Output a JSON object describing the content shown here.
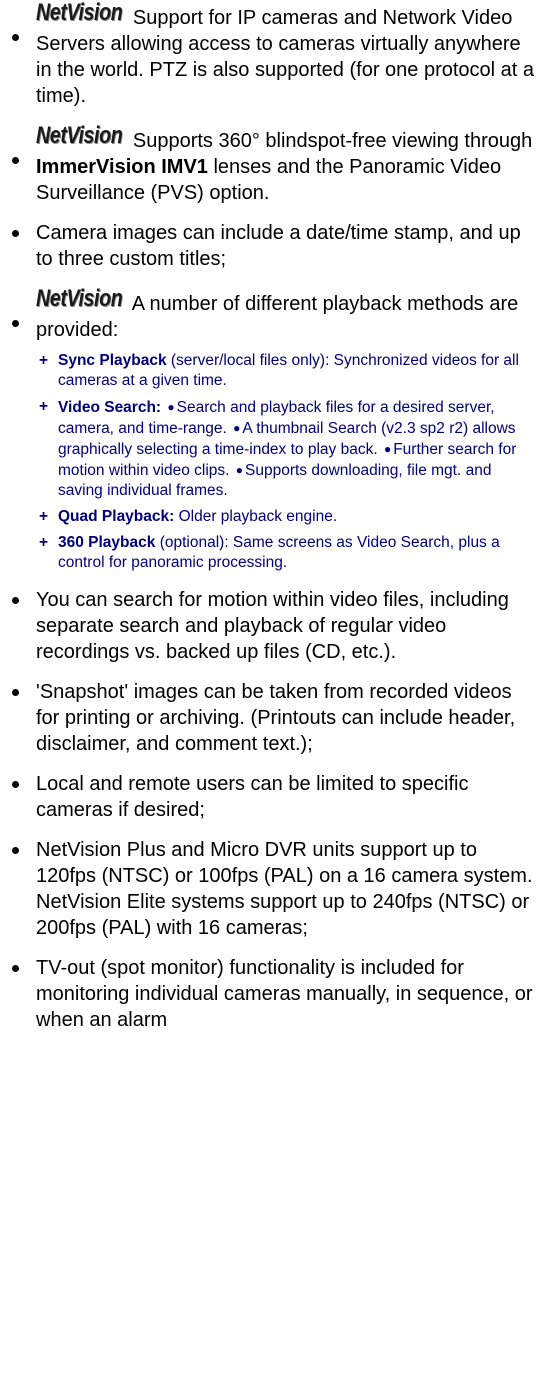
{
  "brand": {
    "logo_text": "NetVision"
  },
  "items": [
    {
      "text": "Support for IP cameras and Network Video Servers allowing access to cameras virtually anywhere in the world. PTZ is also supported (for one protocol at a time)."
    },
    {
      "before": "Supports 360° blindspot-free viewing through ",
      "bold": "ImmerVision IMV1",
      "after": " lenses and the Panoramic Video Surveillance (PVS) option."
    },
    {
      "text": "Camera images can include a date/time stamp, and up to three custom titles;"
    },
    {
      "text": "A number of different playback methods are provided:"
    },
    {
      "text": "You can search for motion within video files, including separate search and playback of regular video recordings vs. backed up files (CD, etc.)."
    },
    {
      "text": "'Snapshot' images can be taken from recorded videos for printing or archiving. (Printouts can include header, disclaimer, and comment text.);"
    },
    {
      "text": "Local and remote users can be limited to specific cameras if desired;"
    },
    {
      "text": "NetVision Plus and Micro DVR units support up to 120fps (NTSC) or 100fps (PAL) on a 16 camera system.  NetVision Elite systems support up to 240fps (NTSC) or 200fps (PAL) with 16 cameras;"
    },
    {
      "text": "TV-out (spot monitor) functionality is included for monitoring individual cameras manually, in sequence, or when an alarm"
    }
  ],
  "playback": [
    {
      "title": "Sync Playback",
      "rest": " (server/local files only): Synchronized videos for all cameras at a given time."
    },
    {
      "title": "Video Search:",
      "parts": [
        "Search and playback files for a desired server, camera, and time-range.",
        "A thumbnail Search (v2.3 sp2 r2) allows graphically selecting a time-index to play back.",
        "Further search for motion within video clips.",
        "Supports downloading, file mgt. and saving individual frames."
      ]
    },
    {
      "title": "Quad Playback:",
      "rest": "  Older playback engine."
    },
    {
      "title": "360 Playback",
      "rest": " (optional):  Same screens as Video Search, plus a control for panoramic processing."
    }
  ]
}
